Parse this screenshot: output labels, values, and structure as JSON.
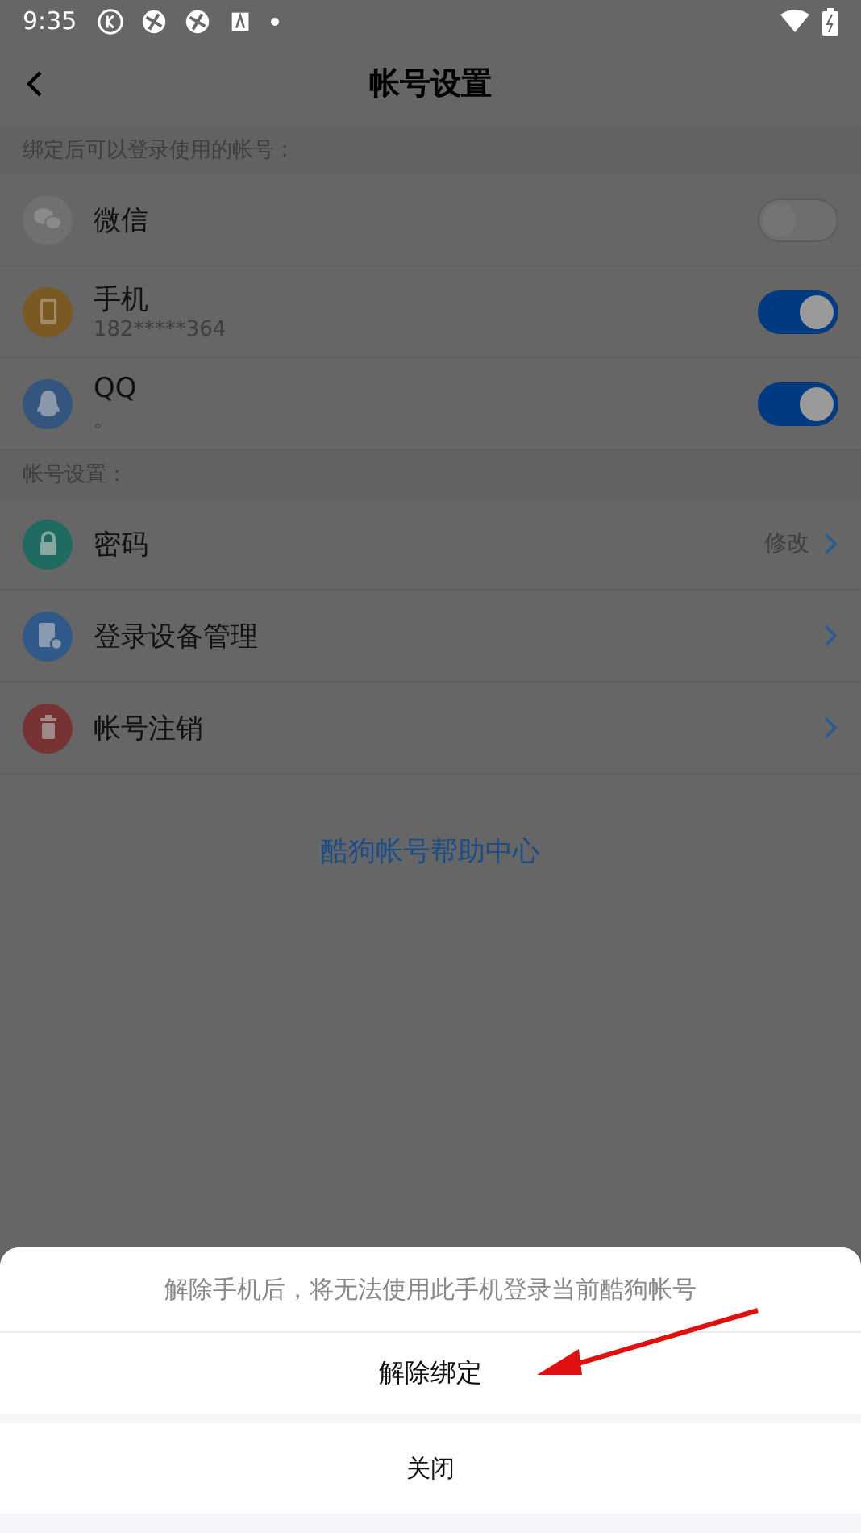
{
  "status_bar": {
    "time": "9:35"
  },
  "header": {
    "title": "帐号设置"
  },
  "bindings": {
    "label": "绑定后可以登录使用的帐号：",
    "items": [
      {
        "kind": "chat",
        "color": "#707070",
        "name": "微信",
        "on": false
      },
      {
        "kind": "phone",
        "color": "#7a5a22",
        "name": "手机",
        "detail": "182*****364",
        "on": true
      },
      {
        "kind": "penguin",
        "color": "#34557e",
        "name": "QQ",
        "detail": "。",
        "on": true
      }
    ]
  },
  "account": {
    "label": "帐号设置：",
    "items": [
      {
        "kind": "lock",
        "color": "#1f6b61",
        "name": "密码",
        "value": "修改"
      },
      {
        "kind": "device",
        "color": "#30598a",
        "name": "登录设备管理"
      },
      {
        "kind": "trash",
        "color": "#773333",
        "name": "帐号注销"
      }
    ]
  },
  "help_link": "酷狗帐号帮助中心",
  "sheet": {
    "message": "解除手机后，将无法使用此手机登录当前酷狗帐号",
    "confirm": "解除绑定",
    "close": "关闭"
  }
}
